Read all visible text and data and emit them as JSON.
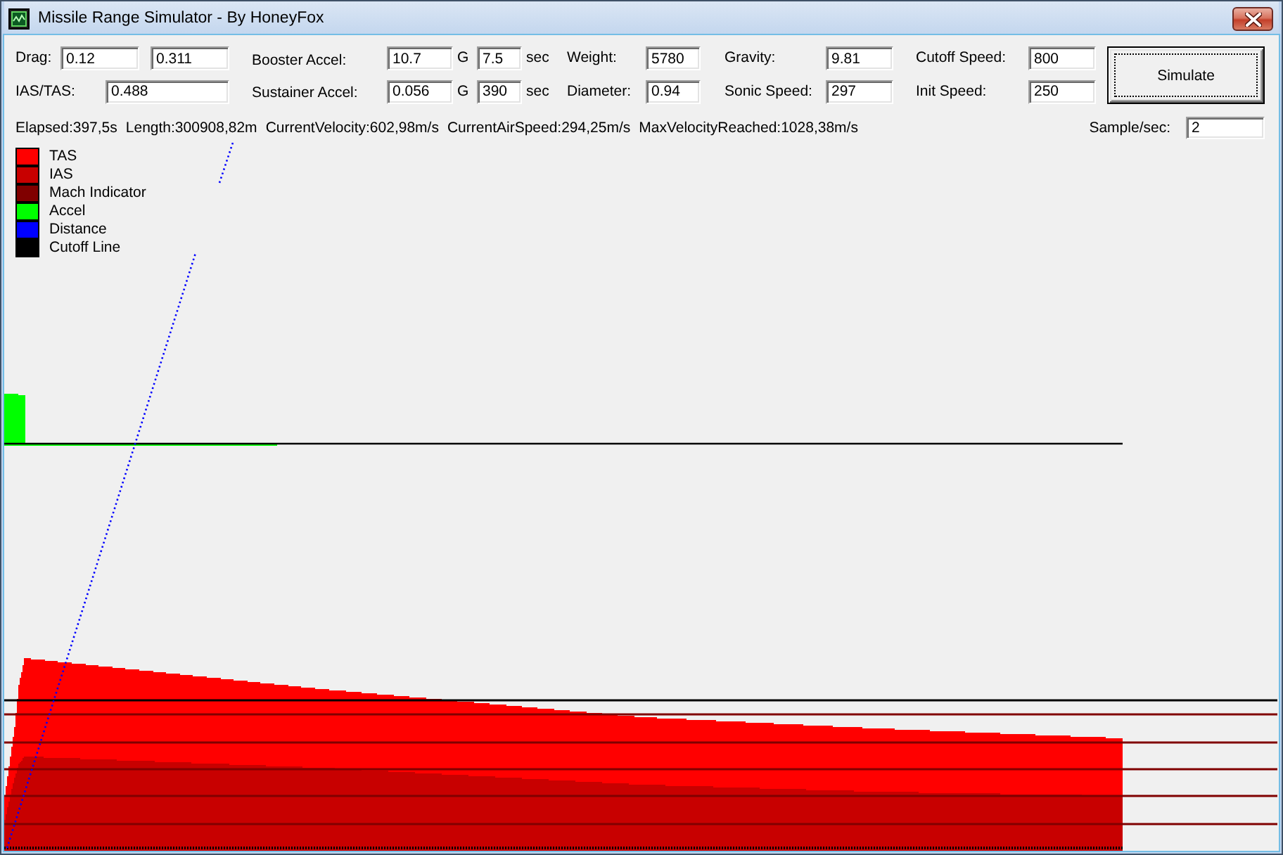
{
  "window": {
    "title": "Missile Range Simulator - By HoneyFox"
  },
  "left_fields": [
    {
      "label": "Drag:",
      "values": [
        "0.12",
        "0.311"
      ]
    },
    {
      "label": "IAS/TAS:",
      "values": [
        "0.488"
      ]
    }
  ],
  "accel_fields": [
    {
      "label": "Booster Accel:",
      "value": "10.7",
      "unit": "G",
      "time": "7.5",
      "time_unit": "sec"
    },
    {
      "label": "Sustainer Accel:",
      "value": "0.056",
      "unit": "G",
      "time": "390",
      "time_unit": "sec"
    }
  ],
  "field_columns": [
    [
      {
        "label": "Weight:",
        "value": "5780"
      },
      {
        "label": "Diameter:",
        "value": "0.94"
      }
    ],
    [
      {
        "label": "Gravity:",
        "value": "9.81"
      },
      {
        "label": "Sonic Speed:",
        "value": "297"
      }
    ],
    [
      {
        "label": "Cutoff Speed:",
        "value": "800"
      },
      {
        "label": "Init Speed:",
        "value": "250"
      }
    ]
  ],
  "simulate_button": {
    "label": "Simulate"
  },
  "status": [
    "Elapsed:397,5s",
    "Length:300908,82m",
    "CurrentVelocity:602,98m/s",
    "CurrentAirSpeed:294,25m/s",
    "MaxVelocityReached:1028,38m/s"
  ],
  "sample_rate": {
    "label": "Sample/sec:",
    "value": "2"
  },
  "legend": [
    {
      "label": "TAS",
      "color": "#ff0000"
    },
    {
      "label": "IAS",
      "color": "#c80000"
    },
    {
      "label": "Mach Indicator",
      "color": "#800000"
    },
    {
      "label": "Accel",
      "color": "#00ff00"
    },
    {
      "label": "Distance",
      "color": "#0000ff"
    },
    {
      "label": "Cutoff Line",
      "color": "#000000"
    }
  ]
}
